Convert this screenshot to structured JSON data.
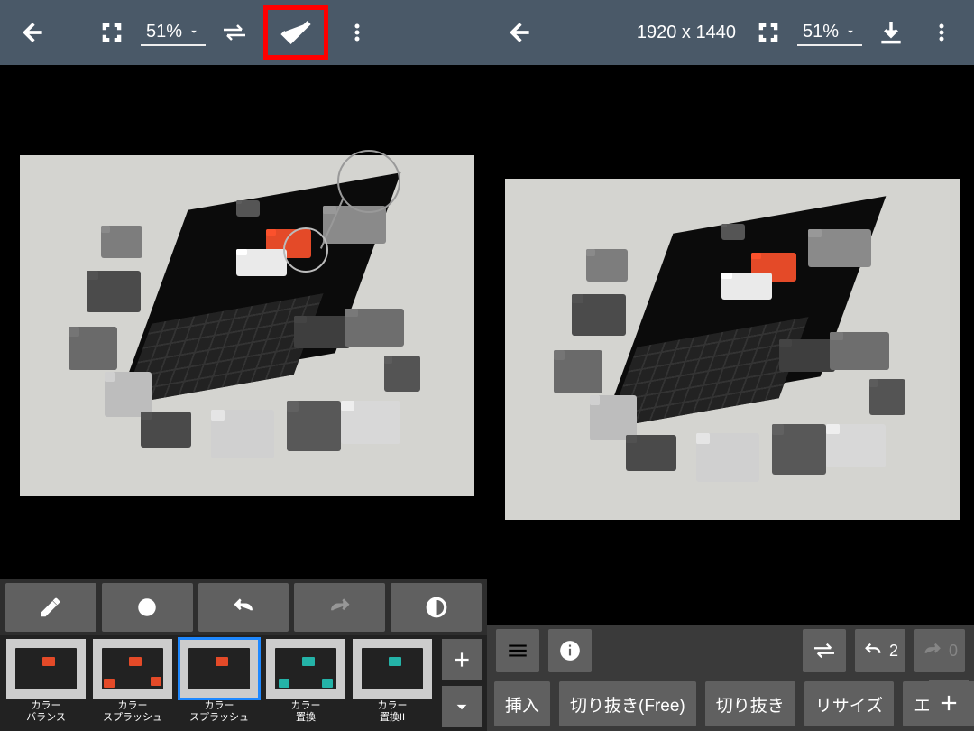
{
  "left": {
    "topbar": {
      "back_icon": "arrow-left",
      "fullscreen_icon": "fullscreen",
      "zoom_label": "51%",
      "swap_icon": "swap-horiz",
      "confirm_icon": "check",
      "menu_icon": "more-vert"
    },
    "editor": {
      "pin_magnifier": true
    },
    "tool_row": [
      {
        "name": "edit-pencil",
        "interactable": true
      },
      {
        "name": "target-circle",
        "interactable": true
      },
      {
        "name": "undo",
        "interactable": true
      },
      {
        "name": "redo",
        "interactable": false
      },
      {
        "name": "contrast-circle",
        "interactable": true
      }
    ],
    "filters": [
      {
        "id": "color-balance",
        "label": "カラー\nバランス",
        "accent": "none"
      },
      {
        "id": "color-splash-1",
        "label": "カラー\nスプラッシュ",
        "accent": "orange"
      },
      {
        "id": "color-splash-2",
        "label": "カラー\nスプラッシュ",
        "accent": "orange",
        "selected": true
      },
      {
        "id": "color-replace-1",
        "label": "カラー\n置換",
        "accent": "teal"
      },
      {
        "id": "color-replace-2",
        "label": "カラー\n置換II",
        "accent": "teal"
      }
    ],
    "side_buttons": {
      "plus_icon": "plus",
      "chevron_icon": "chevron-down"
    }
  },
  "right": {
    "topbar": {
      "back_icon": "arrow-left",
      "dimensions_label": "1920 x 1440",
      "fullscreen_icon": "fullscreen",
      "zoom_label": "51%",
      "download_icon": "download",
      "menu_icon": "more-vert"
    },
    "row1": {
      "menu_icon": "menu",
      "info_icon": "info",
      "swap_icon": "swap-horiz",
      "undo_label": "2",
      "redo_label": "0"
    },
    "tabs": [
      {
        "id": "insert",
        "label": "挿入"
      },
      {
        "id": "crop-free",
        "label": "切り抜き(Free)"
      },
      {
        "id": "crop",
        "label": "切り抜き"
      },
      {
        "id": "resize",
        "label": "リサイズ"
      },
      {
        "id": "effect",
        "label": "エフェ"
      }
    ],
    "plus_icon": "plus"
  }
}
